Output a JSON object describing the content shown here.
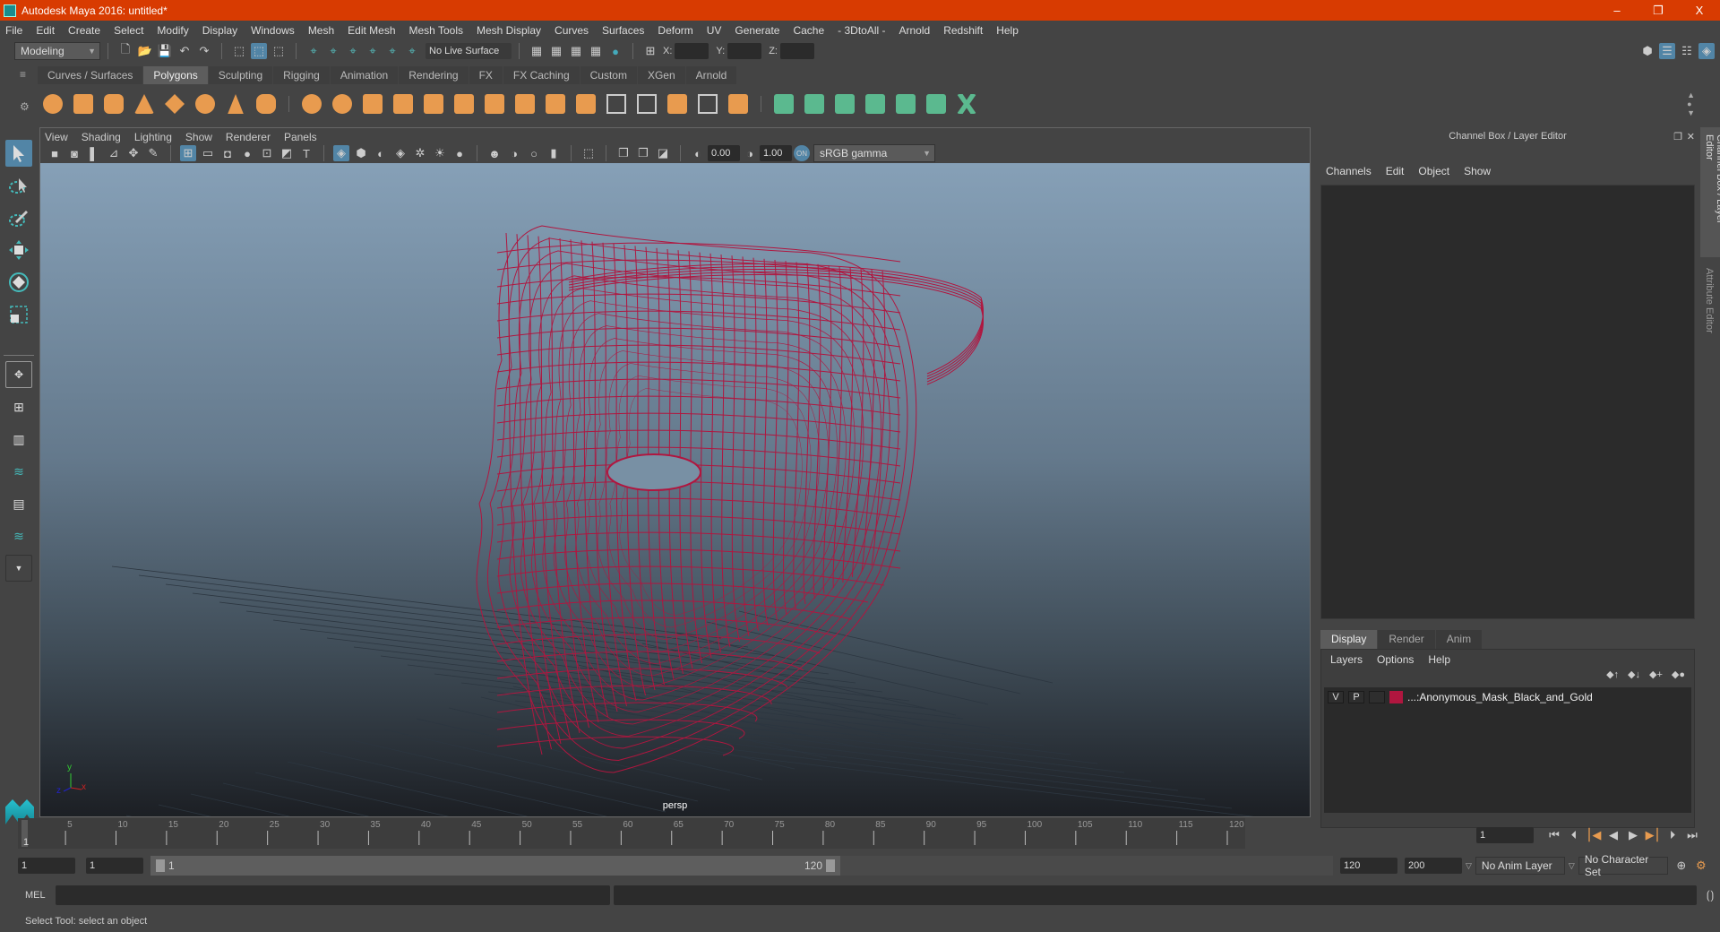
{
  "window": {
    "title": "Autodesk Maya 2016: untitled*",
    "minimize": "–",
    "maximize": "❐",
    "close": "X"
  },
  "menubar": [
    "File",
    "Edit",
    "Create",
    "Select",
    "Modify",
    "Display",
    "Windows",
    "Mesh",
    "Edit Mesh",
    "Mesh Tools",
    "Mesh Display",
    "Curves",
    "Surfaces",
    "Deform",
    "UV",
    "Generate",
    "Cache",
    "- 3DtoAll -",
    "Arnold",
    "Redshift",
    "Help"
  ],
  "statusline": {
    "workspace_menu": "Modeling",
    "live_surface": "No Live Surface",
    "x_label": "X:",
    "y_label": "Y:",
    "z_label": "Z:",
    "x_value": "",
    "y_value": "",
    "z_value": ""
  },
  "shelf": {
    "tabs": [
      "Curves / Surfaces",
      "Polygons",
      "Sculpting",
      "Rigging",
      "Animation",
      "Rendering",
      "FX",
      "FX Caching",
      "Custom",
      "XGen",
      "Arnold"
    ],
    "active_tab": "Polygons",
    "icons": [
      "poly-sphere",
      "poly-cube",
      "poly-cylinder",
      "poly-cone",
      "poly-platonic",
      "poly-torus",
      "poly-pyramid",
      "poly-pipe",
      "combine",
      "separate",
      "mirror",
      "smooth",
      "bevel",
      "extrude",
      "multi-cut",
      "bridge",
      "append-poly",
      "insert-edge-loop",
      "offset-edge-loop",
      "slide-edge",
      "fill-hole",
      "quad-draw",
      "planar-uv",
      "cylindrical-uv",
      "spherical-uv",
      "automatic-uv",
      "uv-editor",
      "unfold-uv"
    ]
  },
  "viewport": {
    "menus": [
      "View",
      "Shading",
      "Lighting",
      "Show",
      "Renderer",
      "Panels"
    ],
    "exposure": "0.00",
    "gamma": "1.00",
    "color_space": "sRGB gamma",
    "camera_label": "persp",
    "wire_color": "#b0163f",
    "axis": {
      "x": "x",
      "y": "y",
      "z": "z"
    }
  },
  "toolbox": [
    "select-tool",
    "lasso-tool",
    "paint-select-tool",
    "move-tool",
    "rotate-tool",
    "scale-tool"
  ],
  "channel_box": {
    "title": "Channel Box / Layer Editor",
    "menus": [
      "Channels",
      "Edit",
      "Object",
      "Show"
    ]
  },
  "layer_editor": {
    "tabs": [
      "Display",
      "Render",
      "Anim"
    ],
    "active_tab": "Display",
    "menus": [
      "Layers",
      "Options",
      "Help"
    ],
    "layers": [
      {
        "visible": "V",
        "playback": "P",
        "color": "#b0163f",
        "name": "...:Anonymous_Mask_Black_and_Gold"
      }
    ]
  },
  "side_tabs": [
    "Channel Box / Layer Editor",
    "Attribute Editor"
  ],
  "timeline": {
    "ticks": [
      "5",
      "10",
      "15",
      "20",
      "25",
      "30",
      "35",
      "40",
      "45",
      "50",
      "55",
      "60",
      "65",
      "70",
      "75",
      "80",
      "85",
      "90",
      "95",
      "100",
      "105",
      "110",
      "115",
      "120"
    ],
    "start_marker": "1",
    "current_frame": "1"
  },
  "range": {
    "start": "1",
    "playback_start": "1",
    "slider_min_label": "1",
    "slider_max_label": "120",
    "playback_end": "120",
    "end": "200",
    "anim_layer": "No Anim Layer",
    "character_set": "No Character Set"
  },
  "command_line": {
    "label": "MEL",
    "input": "",
    "result": ""
  },
  "help_line": "Select Tool: select an object"
}
